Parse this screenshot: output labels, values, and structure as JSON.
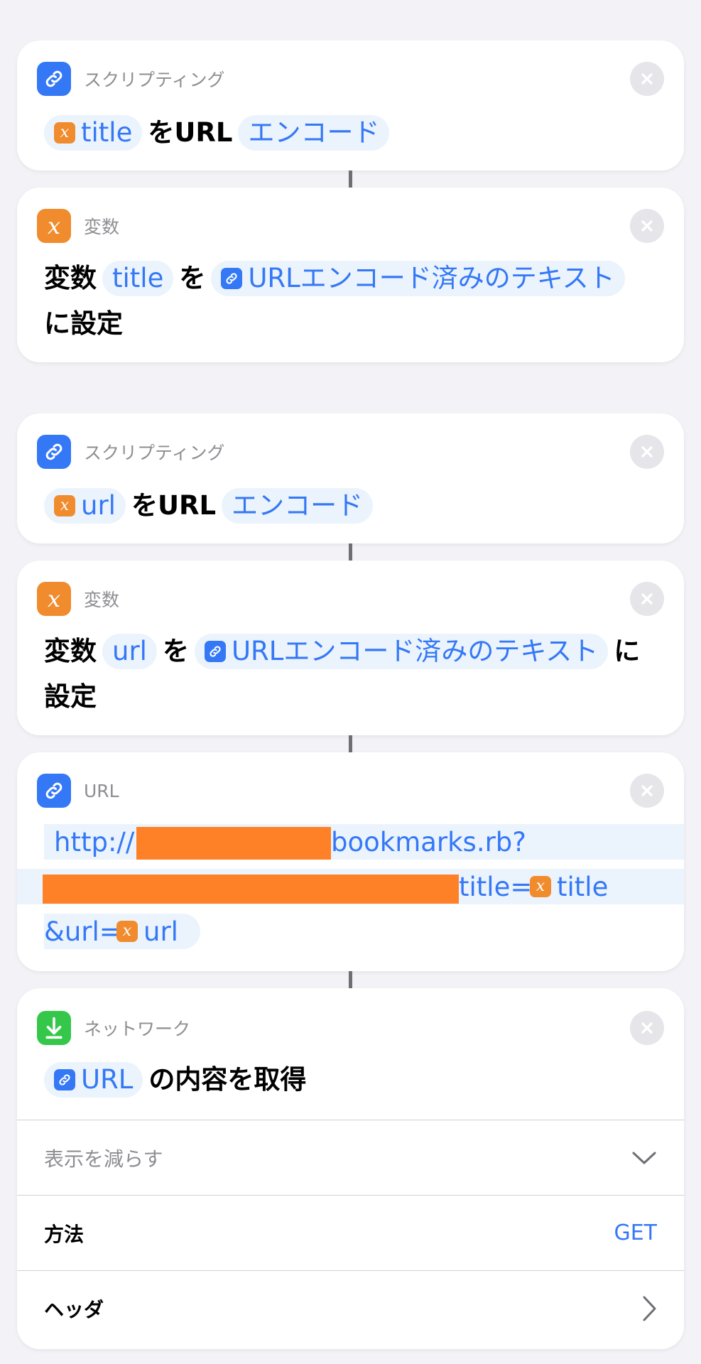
{
  "actions": [
    {
      "category": "スクリプティング",
      "var_token": "title",
      "middle": "をURL",
      "mode": "エンコード"
    },
    {
      "category": "変数",
      "prefix": "変数",
      "var_name": "title",
      "particle": "を",
      "value_token": "URLエンコード済みのテキスト",
      "suffix": "に設定"
    },
    {
      "category": "スクリプティング",
      "var_token": "url",
      "middle": "をURL",
      "mode": "エンコード"
    },
    {
      "category": "変数",
      "prefix": "変数",
      "var_name": "url",
      "particle": "を",
      "value_token": "URLエンコード済みのテキスト",
      "suffix_a": "に",
      "suffix_b": "設定"
    },
    {
      "category": "URL",
      "part1": "http://",
      "part2": "bookmarks.rb?",
      "part3": "title=",
      "var1": "title",
      "part4": "&url=",
      "var2": "url"
    },
    {
      "category": "ネットワーク",
      "token": "URL",
      "suffix": "の内容を取得",
      "show_less": "表示を減らす",
      "method_label": "方法",
      "method_value": "GET",
      "headers_label": "ヘッダ"
    }
  ],
  "colors": {
    "accent": "#3478f6",
    "variable": "#f08c2e",
    "network": "#35c74a",
    "redaction": "#ff8127"
  }
}
